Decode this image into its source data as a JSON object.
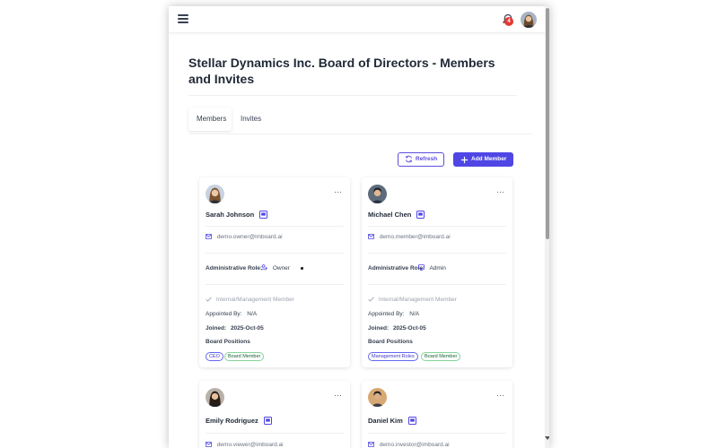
{
  "header": {
    "notification_count": "4"
  },
  "page": {
    "title": "Stellar Dynamics Inc. Board of Directors - Members and Invites"
  },
  "tabs": [
    {
      "label": "Members"
    },
    {
      "label": "Invites"
    }
  ],
  "actions": {
    "refresh_label": "Refresh",
    "add_member_label": "Add Member"
  },
  "labels": {
    "admin_role": "Administrative Role:",
    "internal": "Internal/Management Member",
    "appointed_by": "Appointed By:",
    "joined": "Joined:",
    "board_positions": "Board Positions"
  },
  "members": [
    {
      "name": "Sarah Johnson",
      "email": "demo.owner@imboard.ai",
      "role": "Owner",
      "appointed_by": "N/A",
      "joined": "2025-Oct-05",
      "positions": [
        "CEO",
        "Board Member"
      ]
    },
    {
      "name": "Michael Chen",
      "email": "demo.member@imboard.ai",
      "role": "Admin",
      "appointed_by": "N/A",
      "joined": "2025-Oct-05",
      "positions": [
        "Management Roles",
        "Board Member"
      ]
    },
    {
      "name": "Emily Rodriguez",
      "email": "demo.viewer@imboard.ai"
    },
    {
      "name": "Daniel Kim",
      "email": "demo.investor@imboard.ai"
    }
  ],
  "colors": {
    "accent": "#4f46e5",
    "badge": "#e53935",
    "chip_blue": "#6366f1",
    "chip_green": "#86d39a"
  },
  "icons": [
    "menu-icon",
    "bell-icon",
    "refresh-icon",
    "plus-icon",
    "more-icon",
    "id-card-icon",
    "mail-icon",
    "owner-icon",
    "admin-icon",
    "check-icon"
  ]
}
